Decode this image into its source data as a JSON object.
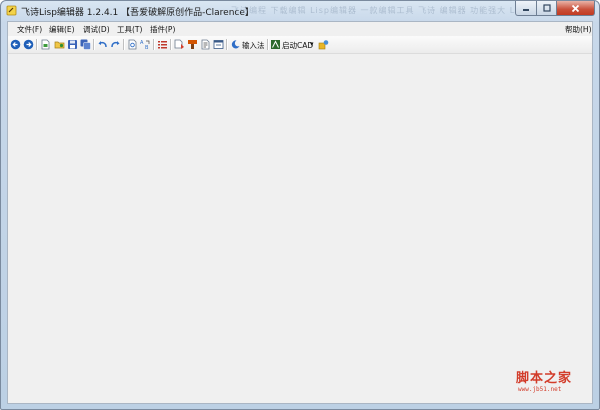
{
  "window": {
    "title": "飞诗Lisp编辑器 1.2.4.1 【吾爱破解原创作品-Clarence】",
    "blurred_text": "飞诗编程 下载编辑 Lisp编辑器 一款编辑工具 飞诗 编辑器 功能强大 Lisp"
  },
  "menubar": {
    "items": [
      {
        "label": "文件(F)"
      },
      {
        "label": "编辑(E)"
      },
      {
        "label": "调试(D)"
      },
      {
        "label": "工具(T)"
      },
      {
        "label": "插件(P)"
      }
    ],
    "help": "帮助(H)"
  },
  "toolbar": {
    "input_method_label": "输入法",
    "start_cad_label": "启动CAD",
    "dropdown_arrow": "▾"
  },
  "watermark": {
    "main": "脚本之家",
    "sub": "www.jb51.net"
  },
  "colors": {
    "accent_red": "#d23c2a",
    "workspace": "#f0f0f0"
  }
}
